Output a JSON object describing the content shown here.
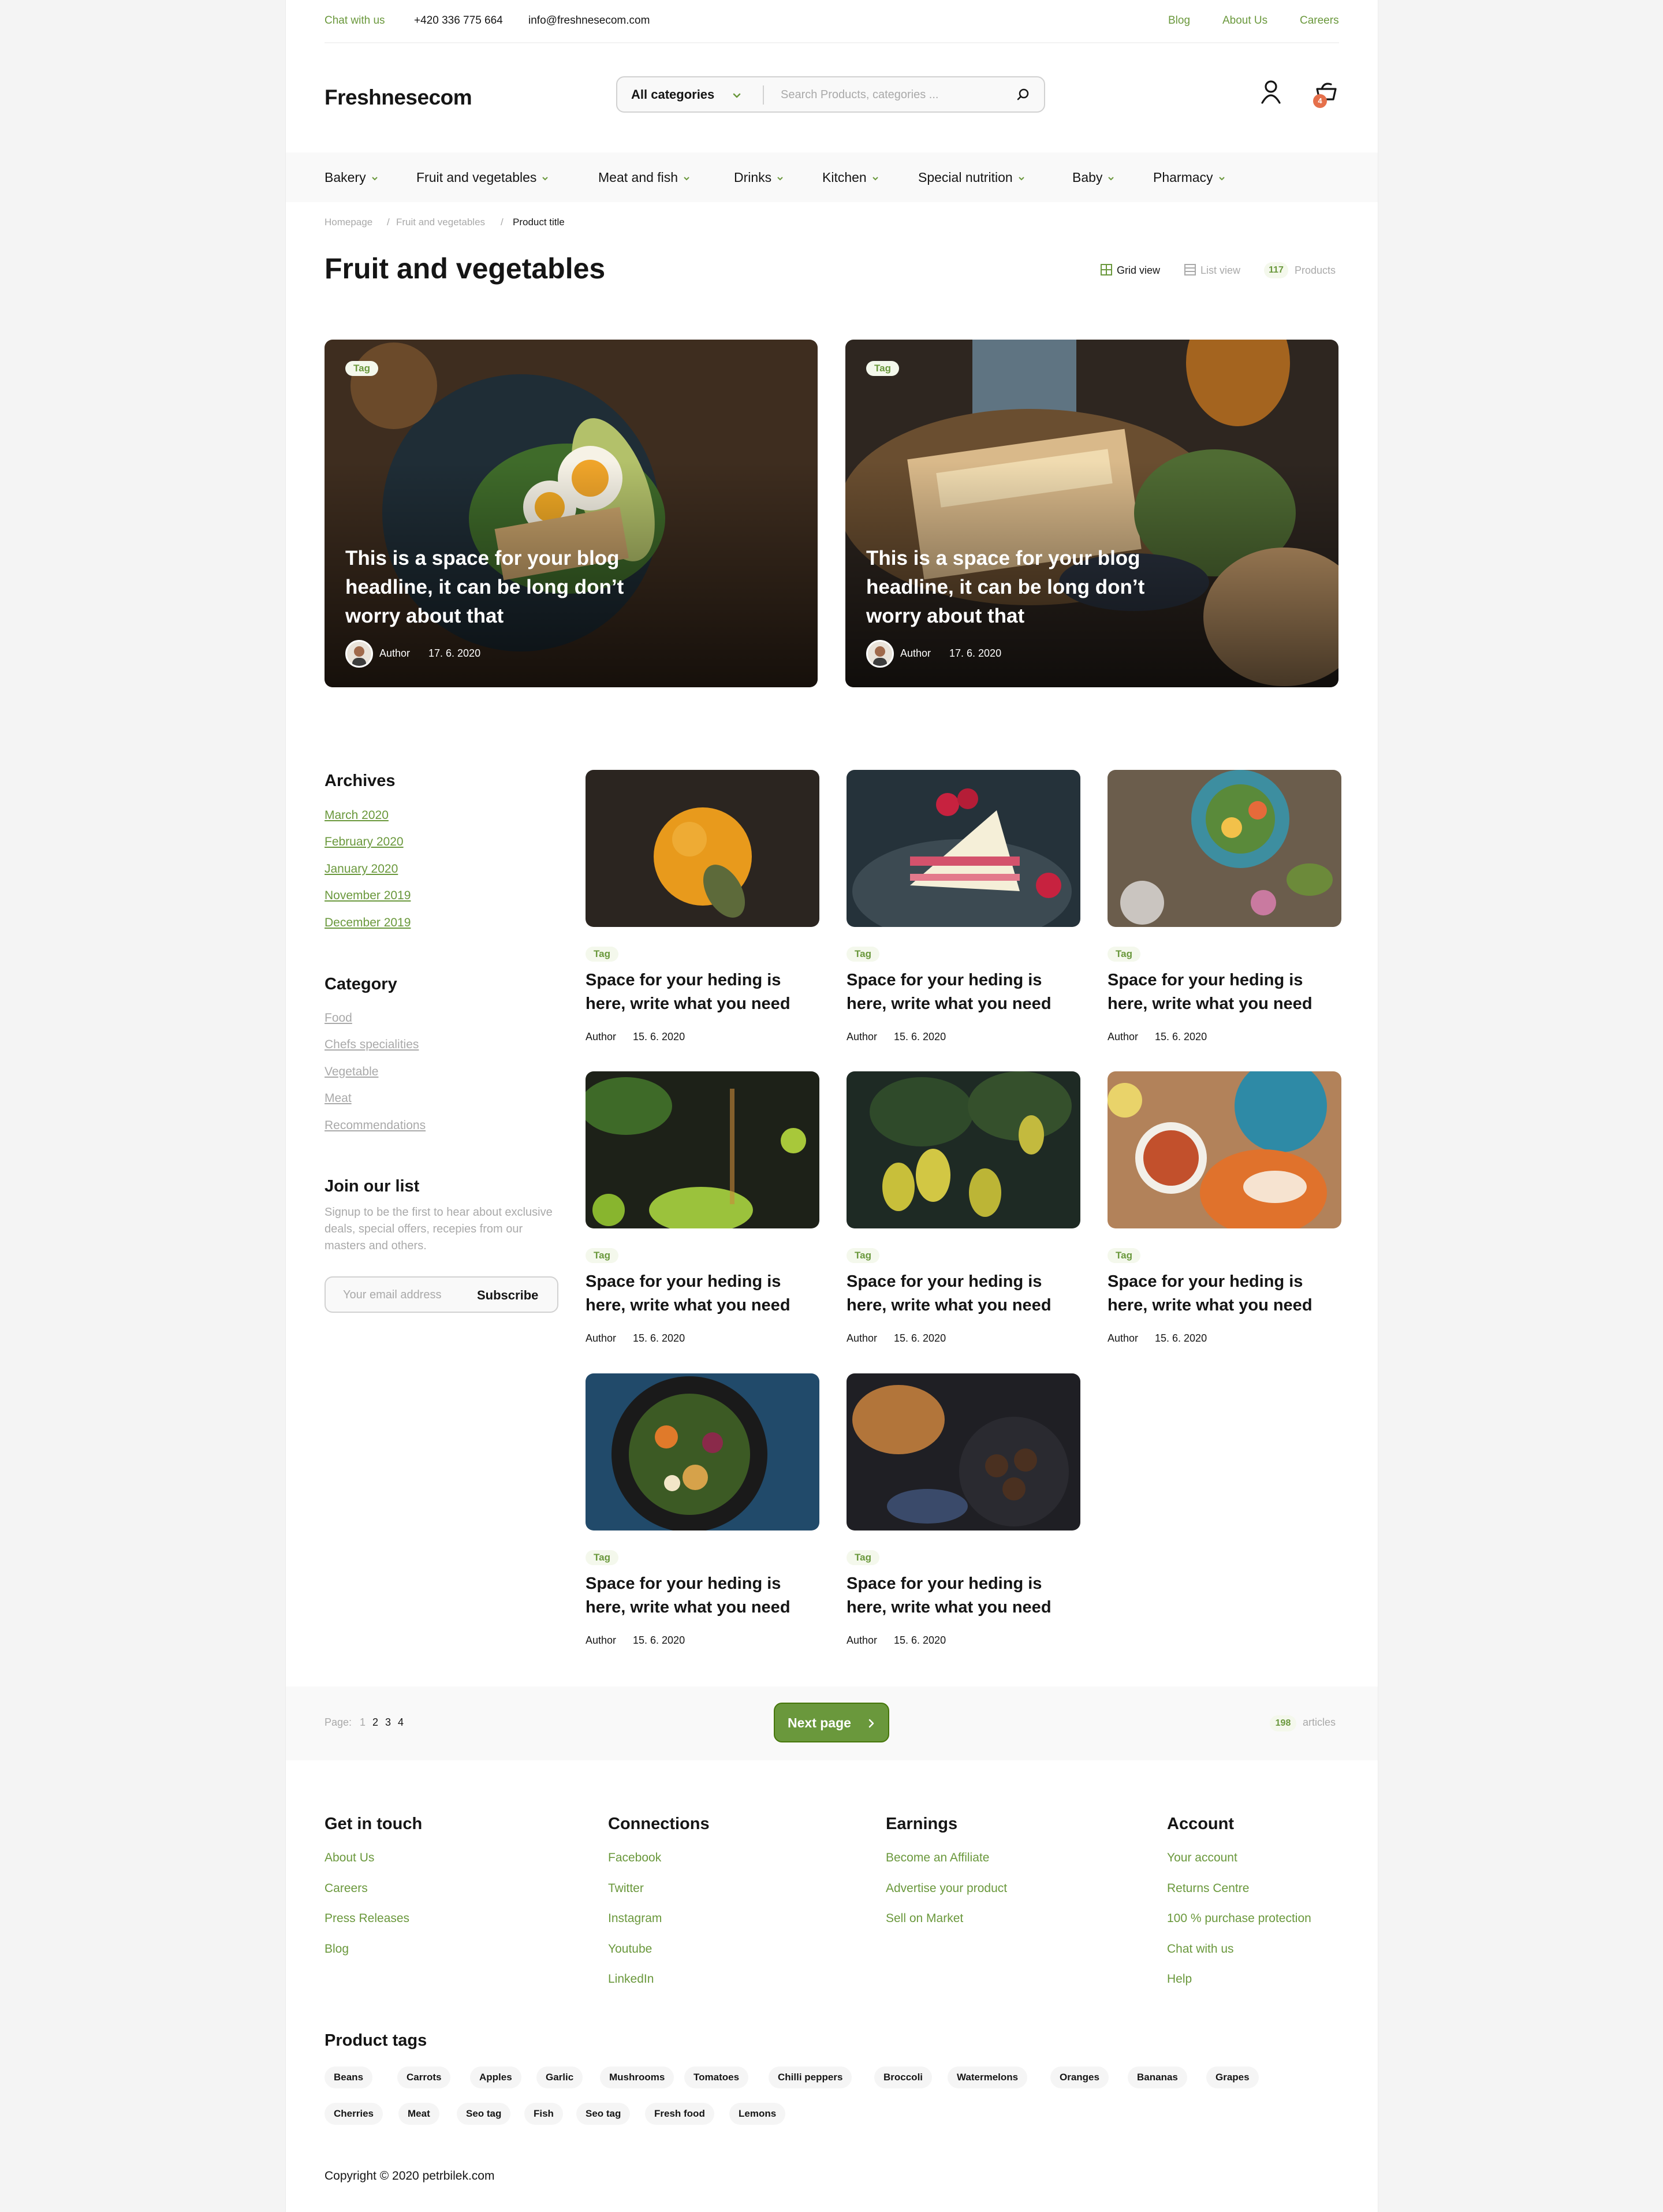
{
  "topbar": {
    "chat": "Chat with us",
    "phone": "+420 336 775 664",
    "email": "info@freshnesecom.com",
    "links": [
      "Blog",
      "About Us",
      "Careers"
    ]
  },
  "header": {
    "logo": "Freshnesecom",
    "category_select": "All categories",
    "search_placeholder": "Search Products, categories ...",
    "cart_count": "4"
  },
  "nav": {
    "items": [
      "Bakery",
      "Fruit and vegetables",
      "Meat and fish",
      "Drinks",
      "Kitchen",
      "Special nutrition",
      "Baby",
      "Pharmacy"
    ]
  },
  "breadcrumb": [
    "Homepage",
    "Fruit and vegetables",
    "Product title"
  ],
  "page": {
    "title": "Fruit and vegetables",
    "grid_view": "Grid view",
    "list_view": "List view",
    "count": "117",
    "count_label": "Products"
  },
  "hero_posts": [
    {
      "tag": "Tag",
      "headline": "This is a space for your blog headline, it can be long don’t worry about that",
      "author": "Author",
      "date": "17. 6. 2020"
    },
    {
      "tag": "Tag",
      "headline": "This is a space for your blog headline, it can be long don’t worry about that",
      "author": "Author",
      "date": "17. 6. 2020"
    }
  ],
  "sidebar": {
    "archives_title": "Archives",
    "archives": [
      "March 2020",
      "February 2020",
      "January 2020",
      "November 2019",
      "December 2019"
    ],
    "category_title": "Category",
    "categories": [
      "Food",
      "Chefs specialities",
      "Vegetable",
      "Meat",
      "Recommendations"
    ],
    "join_title": "Join our list",
    "join_text": "Signup to be the first to hear about exclusive deals, special offers, recepies from our masters and others.",
    "email_placeholder": "Your email address",
    "subscribe": "Subscribe"
  },
  "posts": [
    {
      "tag": "Tag",
      "title": "Space for your heding is here, write what you need",
      "author": "Author",
      "date": "15. 6. 2020"
    },
    {
      "tag": "Tag",
      "title": "Space for your heding is here, write what you need",
      "author": "Author",
      "date": "15. 6. 2020"
    },
    {
      "tag": "Tag",
      "title": "Space for your heding is here, write what you need",
      "author": "Author",
      "date": "15. 6. 2020"
    },
    {
      "tag": "Tag",
      "title": "Space for your heding is here, write what you need",
      "author": "Author",
      "date": "15. 6. 2020"
    },
    {
      "tag": "Tag",
      "title": "Space for your heding is here, write what you need",
      "author": "Author",
      "date": "15. 6. 2020"
    },
    {
      "tag": "Tag",
      "title": "Space for your heding is here, write what you need",
      "author": "Author",
      "date": "15. 6. 2020"
    },
    {
      "tag": "Tag",
      "title": "Space for your heding is here, write what you need",
      "author": "Author",
      "date": "15. 6. 2020"
    },
    {
      "tag": "Tag",
      "title": "Space for your heding is here, write what you need",
      "author": "Author",
      "date": "15. 6. 2020"
    }
  ],
  "pagination": {
    "label": "Page:",
    "pages": [
      "1",
      "2",
      "3",
      "4"
    ],
    "next": "Next page",
    "count": "198",
    "count_label": "articles"
  },
  "footer": {
    "columns": [
      {
        "title": "Get in touch",
        "links": [
          "About Us",
          "Careers",
          "Press Releases",
          "Blog"
        ]
      },
      {
        "title": "Connections",
        "links": [
          "Facebook",
          "Twitter",
          "Instagram",
          "Youtube",
          "LinkedIn"
        ]
      },
      {
        "title": "Earnings",
        "links": [
          "Become an Affiliate",
          "Advertise your product",
          "Sell on Market"
        ]
      },
      {
        "title": "Account",
        "links": [
          "Your account",
          "Returns Centre",
          "100 % purchase protection",
          "Chat with us",
          "Help"
        ]
      }
    ],
    "tags_title": "Product tags",
    "tags": [
      "Beans",
      "Carrots",
      "Apples",
      "Garlic",
      "Mushrooms",
      "Tomatoes",
      "Chilli peppers",
      "Broccoli",
      "Watermelons",
      "Oranges",
      "Bananas",
      "Grapes",
      "Cherries",
      "Meat",
      "Seo tag",
      "Fish",
      "Seo tag",
      "Fresh food",
      "Lemons"
    ],
    "copyright": "Copyright © 2020 petrbilek.com"
  },
  "colors": {
    "accent": "#6a983c",
    "accent_dark": "#46760a",
    "badge": "#e5704b",
    "tag_bg": "#f4f8ec",
    "text": "#151515",
    "muted": "#a9a9a9"
  }
}
